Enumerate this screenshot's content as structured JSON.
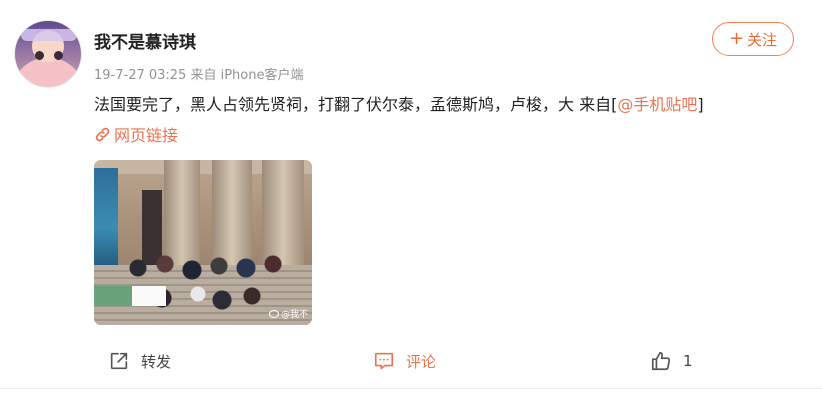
{
  "post": {
    "username": "我不是慕诗琪",
    "meta": "19-7-27 03:25  来自 iPhone客户端",
    "follow_label": "关注",
    "content_text": "法国要完了，黑人占领先贤祠，打翻了伏尔泰，孟德斯鸠，卢梭，大 来自[",
    "mention": "@手机贴吧",
    "content_close": "]",
    "link_label": "网页链接",
    "image_watermark": "@我不"
  },
  "actions": {
    "repost_label": "转发",
    "comment_label": "评论",
    "like_count": "1"
  },
  "colors": {
    "accent": "#eb7350",
    "text": "#222222",
    "meta": "#939393"
  },
  "icons": [
    "link-icon",
    "repost-icon",
    "comment-icon",
    "like-icon",
    "weibo-logo-icon"
  ]
}
